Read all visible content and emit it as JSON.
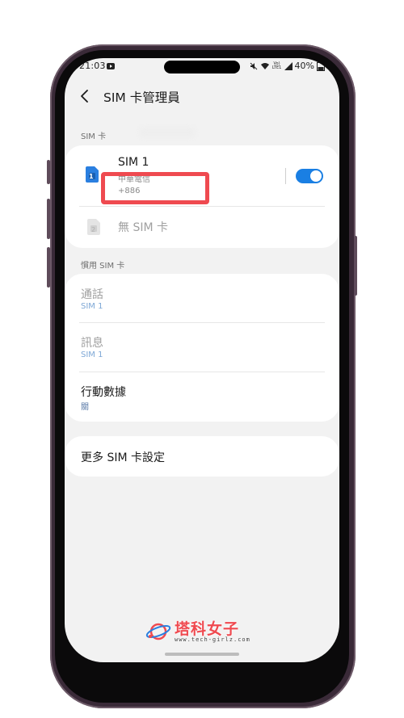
{
  "status_bar": {
    "time": "21:03",
    "battery": "40%",
    "network_label": "Vo) LTE1"
  },
  "header": {
    "title": "SIM 卡管理員"
  },
  "sim_section": {
    "title": "SIM 卡",
    "sim1": {
      "name": "SIM 1",
      "carrier": "中華電信",
      "number": "+886",
      "slot": "1",
      "enabled": true
    },
    "sim2": {
      "label": "無 SIM 卡",
      "slot": "2"
    }
  },
  "preferred_section": {
    "title": "慣用 SIM 卡",
    "calls": {
      "label": "通話",
      "value": "SIM 1"
    },
    "messages": {
      "label": "訊息",
      "value": "SIM 1"
    },
    "mobile_data": {
      "label": "行動數據",
      "value": "關"
    }
  },
  "more_settings": {
    "label": "更多 SIM 卡設定"
  },
  "watermark": {
    "title": "塔科女子",
    "url": "www.tech-girlz.com"
  },
  "colors": {
    "accent": "#1a7fe3",
    "highlight": "#ef4a50",
    "background": "#f2f2f2"
  }
}
